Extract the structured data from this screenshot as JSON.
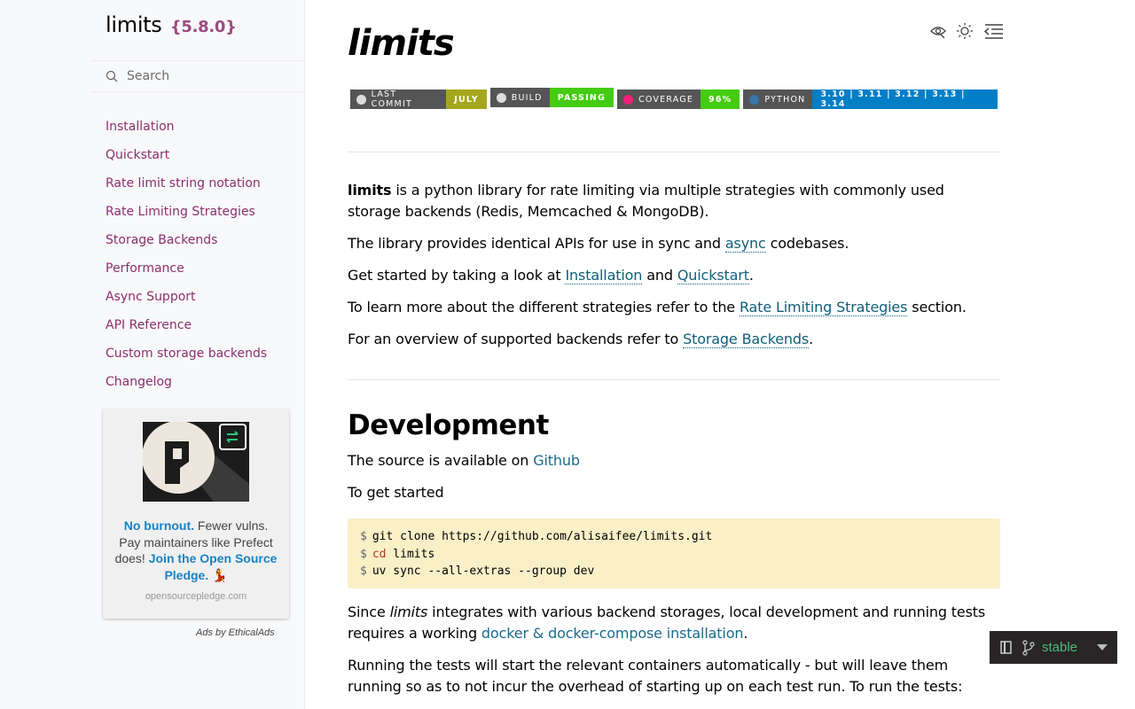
{
  "sidebar": {
    "brand": "limits",
    "version": "{5.8.0}",
    "search_placeholder": "Search",
    "items": [
      {
        "label": "Installation"
      },
      {
        "label": "Quickstart"
      },
      {
        "label": "Rate limit string notation"
      },
      {
        "label": "Rate Limiting Strategies"
      },
      {
        "label": "Storage Backends"
      },
      {
        "label": "Performance"
      },
      {
        "label": "Async Support"
      },
      {
        "label": "API Reference"
      },
      {
        "label": "Custom storage backends"
      },
      {
        "label": "Changelog"
      }
    ],
    "ad": {
      "text_bold_1": "No burnout.",
      "text_1": " Fewer vulns. Pay maintainers like Prefect does! ",
      "text_bold_2": "Join the Open Source Pledge.",
      "emoji": "💃",
      "domain": "opensourcepledge.com",
      "ads_by": "Ads by EthicalAds"
    }
  },
  "page": {
    "title": "limits",
    "badges": [
      {
        "label": "LAST COMMIT",
        "value": "JULY",
        "color": "#a4a61d"
      },
      {
        "label": "BUILD",
        "value": "PASSING",
        "color": "#4c1"
      },
      {
        "label": "COVERAGE",
        "value": "96%",
        "color": "#4c1"
      },
      {
        "label": "PYTHON",
        "value": "3.10 | 3.11 | 3.12 | 3.13 | 3.14",
        "color": "#007ec6"
      }
    ],
    "intro": {
      "strong": "limits",
      "rest": " is a python library for rate limiting via multiple strategies with commonly used storage backends (Redis, Memcached & MongoDB)."
    },
    "p2": {
      "a": "The library provides identical APIs for use in sync and ",
      "link": "async",
      "b": " codebases."
    },
    "p3": {
      "a": "Get started by taking a look at ",
      "link1": "Installation",
      "mid": " and ",
      "link2": "Quickstart",
      "b": "."
    },
    "p4": {
      "a": "To learn more about the different strategies refer to the ",
      "link": "Rate Limiting Strategies",
      "b": " section."
    },
    "p5": {
      "a": "For an overview of supported backends refer to ",
      "link": "Storage Backends",
      "b": "."
    },
    "dev_heading": "Development",
    "dev_p1": {
      "a": "The source is available on ",
      "link": "Github"
    },
    "dev_p2": "To get started",
    "code": {
      "prompt": "$",
      "line1": "git clone https://github.com/alisaifee/limits.git",
      "line2_cmd": "cd",
      "line2_arg": " limits",
      "line3": "uv sync --all-extras --group dev"
    },
    "dev_p3": {
      "a": "Since ",
      "em": "limits",
      "b": " integrates with various backend storages, local development and running tests requires a working ",
      "link": "docker & docker-compose installation",
      "c": "."
    },
    "dev_p4": "Running the tests will start the relevant containers automatically - but will leave them running so as to not incur the overhead of starting up on each test run. To run the tests:"
  },
  "version_selector": {
    "label": "stable"
  }
}
